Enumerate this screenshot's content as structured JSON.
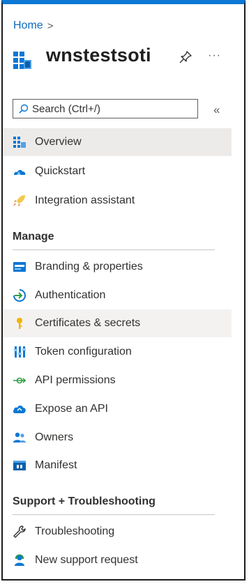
{
  "breadcrumb": {
    "home": "Home",
    "separator": ">"
  },
  "header": {
    "title": "wnstestsoti",
    "more": "···"
  },
  "search": {
    "placeholder": "Search (Ctrl+/)",
    "collapse": "«"
  },
  "nav": {
    "top": [
      {
        "label": "Overview",
        "icon": "overview-icon"
      },
      {
        "label": "Quickstart",
        "icon": "quickstart-icon"
      },
      {
        "label": "Integration assistant",
        "icon": "rocket-icon"
      }
    ],
    "manage_heading": "Manage",
    "manage": [
      {
        "label": "Branding & properties",
        "icon": "branding-icon"
      },
      {
        "label": "Authentication",
        "icon": "authentication-icon"
      },
      {
        "label": "Certificates & secrets",
        "icon": "key-icon"
      },
      {
        "label": "Token configuration",
        "icon": "token-icon"
      },
      {
        "label": "API permissions",
        "icon": "api-permissions-icon"
      },
      {
        "label": "Expose an API",
        "icon": "cloud-icon"
      },
      {
        "label": "Owners",
        "icon": "owners-icon"
      },
      {
        "label": "Manifest",
        "icon": "manifest-icon"
      }
    ],
    "support_heading": "Support + Troubleshooting",
    "support": [
      {
        "label": "Troubleshooting",
        "icon": "wrench-icon"
      },
      {
        "label": "New support request",
        "icon": "support-person-icon"
      }
    ]
  },
  "colors": {
    "accent": "#0a78d4",
    "selected_bg": "#edebe9",
    "link": "#0f6cbd"
  }
}
